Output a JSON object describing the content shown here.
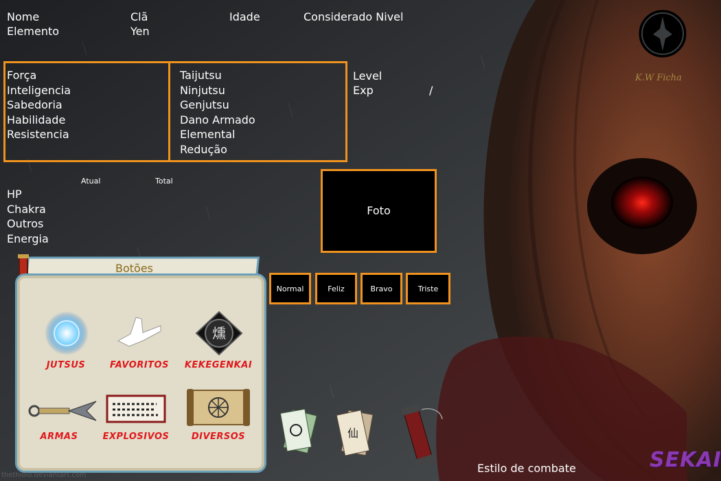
{
  "header": {
    "nome": "Nome",
    "cla": "Clã",
    "idade": "Idade",
    "considerado_nivel": "Considerado Nivel",
    "elemento": "Elemento",
    "yen": "Yen"
  },
  "attributes": [
    "Força",
    "Inteligencia",
    "Sabedoria",
    "Habilidade",
    "Resistencia"
  ],
  "skills": [
    "Taijutsu",
    "Ninjutsu",
    "Genjutsu",
    "Dano Armado",
    "Elemental",
    "Redução"
  ],
  "level": {
    "label": "Level",
    "exp_label": "Exp",
    "separator": "/"
  },
  "resources": {
    "atual": "Atual",
    "total": "Total",
    "rows": [
      "HP",
      "Chakra",
      "Outros",
      "Energia"
    ]
  },
  "photo": {
    "label": "Foto"
  },
  "moods": [
    "Normal",
    "Feliz",
    "Bravo",
    "Triste"
  ],
  "buttons_panel": {
    "title": "Botões",
    "items": [
      "JUTSUS",
      "FAVORITOS",
      "KEKEGENKAI",
      "ARMAS",
      "EXPLOSIVOS",
      "DIVERSOS"
    ]
  },
  "logo": {
    "text": "K.W Ficha"
  },
  "footer": {
    "estilo": "Estilo de combate",
    "brand": "SEKAI",
    "watermark": "thethiolo.deviantart.com"
  },
  "colors": {
    "accent": "#f0931e",
    "button_label": "#e0181c",
    "panel_title": "#8a6a1a"
  }
}
